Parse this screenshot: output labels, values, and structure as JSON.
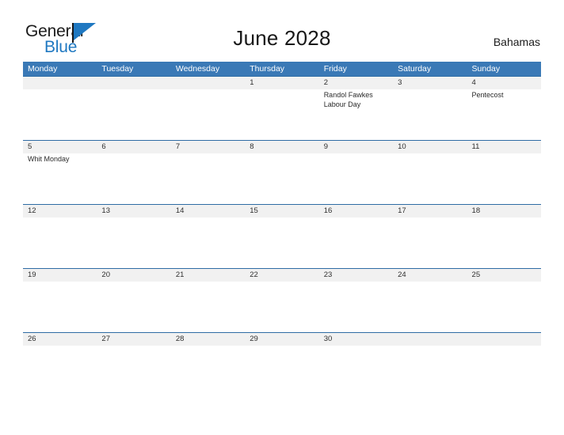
{
  "brand": {
    "name_part1": "General",
    "name_part2": "Blue",
    "accent_color": "#1f78c1"
  },
  "header": {
    "title": "June 2028",
    "country": "Bahamas"
  },
  "calendar": {
    "header_bg": "#3a79b6",
    "row_band_bg": "#f1f1f1",
    "weekdays": [
      "Monday",
      "Tuesday",
      "Wednesday",
      "Thursday",
      "Friday",
      "Saturday",
      "Sunday"
    ],
    "weeks": [
      {
        "days": [
          {
            "number": "",
            "events": []
          },
          {
            "number": "",
            "events": []
          },
          {
            "number": "",
            "events": []
          },
          {
            "number": "1",
            "events": []
          },
          {
            "number": "2",
            "events": [
              "Randol Fawkes",
              "Labour Day"
            ]
          },
          {
            "number": "3",
            "events": []
          },
          {
            "number": "4",
            "events": [
              "Pentecost"
            ]
          }
        ]
      },
      {
        "days": [
          {
            "number": "5",
            "events": [
              "Whit Monday"
            ]
          },
          {
            "number": "6",
            "events": []
          },
          {
            "number": "7",
            "events": []
          },
          {
            "number": "8",
            "events": []
          },
          {
            "number": "9",
            "events": []
          },
          {
            "number": "10",
            "events": []
          },
          {
            "number": "11",
            "events": []
          }
        ]
      },
      {
        "days": [
          {
            "number": "12",
            "events": []
          },
          {
            "number": "13",
            "events": []
          },
          {
            "number": "14",
            "events": []
          },
          {
            "number": "15",
            "events": []
          },
          {
            "number": "16",
            "events": []
          },
          {
            "number": "17",
            "events": []
          },
          {
            "number": "18",
            "events": []
          }
        ]
      },
      {
        "days": [
          {
            "number": "19",
            "events": []
          },
          {
            "number": "20",
            "events": []
          },
          {
            "number": "21",
            "events": []
          },
          {
            "number": "22",
            "events": []
          },
          {
            "number": "23",
            "events": []
          },
          {
            "number": "24",
            "events": []
          },
          {
            "number": "25",
            "events": []
          }
        ]
      },
      {
        "days": [
          {
            "number": "26",
            "events": []
          },
          {
            "number": "27",
            "events": []
          },
          {
            "number": "28",
            "events": []
          },
          {
            "number": "29",
            "events": []
          },
          {
            "number": "30",
            "events": []
          },
          {
            "number": "",
            "events": []
          },
          {
            "number": "",
            "events": []
          }
        ]
      }
    ]
  }
}
